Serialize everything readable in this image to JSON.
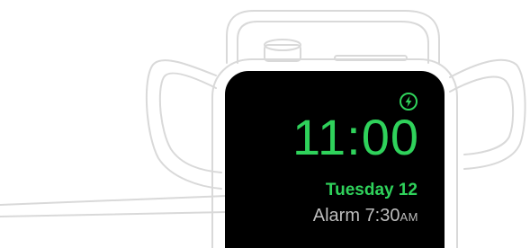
{
  "nightstand": {
    "time": "11:00",
    "date": "Tuesday 12",
    "alarm_label": "Alarm",
    "alarm_time": "7:30",
    "alarm_suffix": "AM",
    "status_icon": "charging-bolt-icon"
  },
  "colors": {
    "accent_green": "#2fd25b",
    "alarm_grey": "#bdbdbd",
    "outline": "#d9d9d9",
    "screen": "#000000"
  }
}
